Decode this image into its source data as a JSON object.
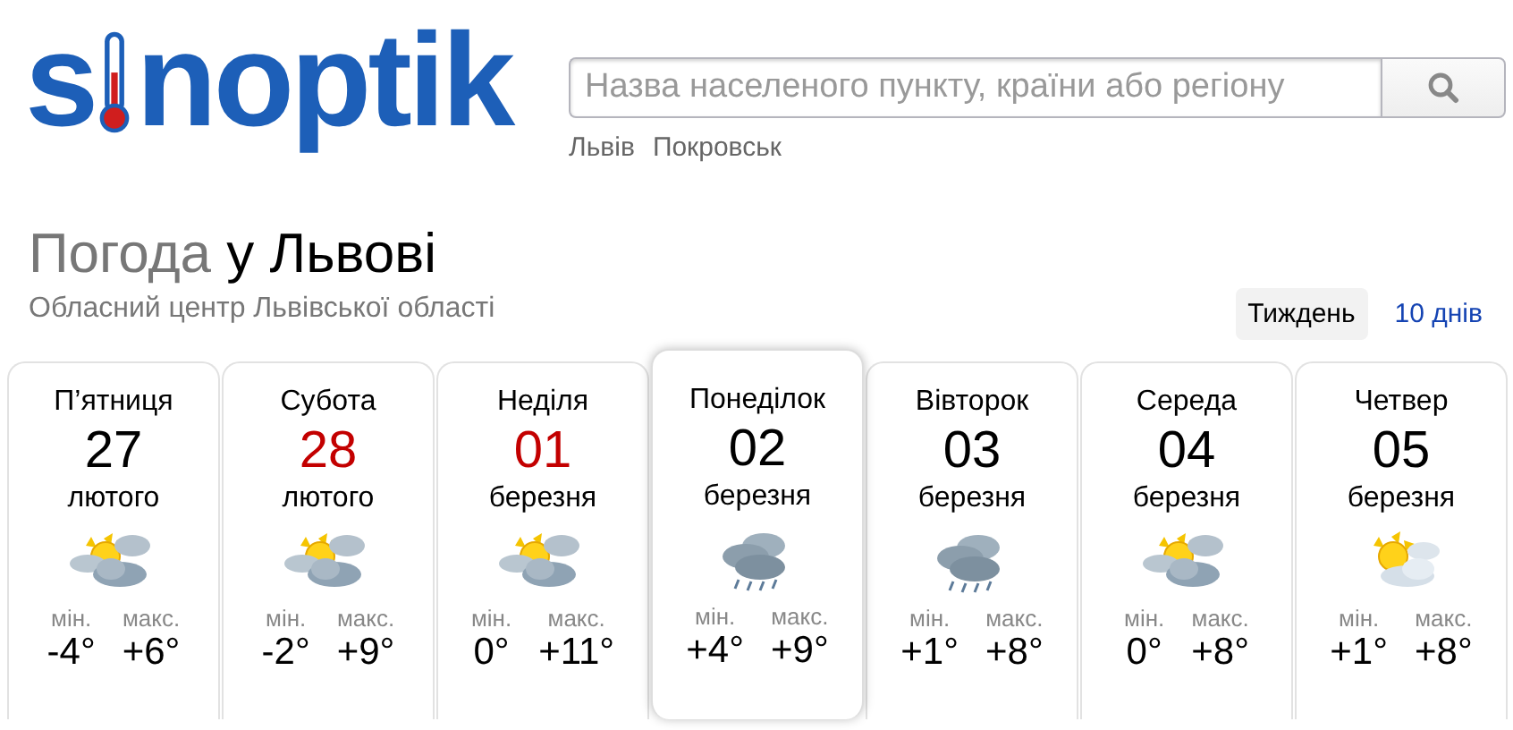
{
  "logo": {
    "text_before": "s",
    "text_after": "noptik"
  },
  "search": {
    "placeholder": "Назва населеного пункту, країни або регіону"
  },
  "recent_links": [
    "Львів",
    "Покровськ"
  ],
  "heading": {
    "prefix": "Погода",
    "city": "у Львові"
  },
  "subtitle": "Обласний центр Львівської області",
  "range_tabs": [
    {
      "label": "Тиждень",
      "selected": true
    },
    {
      "label": "10 днів",
      "selected": false
    }
  ],
  "days": [
    {
      "weekday": "П’ятниця",
      "date": "27",
      "month": "лютого",
      "weekend": false,
      "selected": false,
      "kind": "sun-clouds",
      "min_label": "мін.",
      "min": "-4°",
      "max_label": "макс.",
      "max": "+6°"
    },
    {
      "weekday": "Субота",
      "date": "28",
      "month": "лютого",
      "weekend": true,
      "selected": false,
      "kind": "sun-clouds",
      "min_label": "мін.",
      "min": "-2°",
      "max_label": "макс.",
      "max": "+9°"
    },
    {
      "weekday": "Неділя",
      "date": "01",
      "month": "березня",
      "weekend": true,
      "selected": false,
      "kind": "sun-clouds",
      "min_label": "мін.",
      "min": "0°",
      "max_label": "макс.",
      "max": "+11°"
    },
    {
      "weekday": "Понеділок",
      "date": "02",
      "month": "березня",
      "weekend": false,
      "selected": true,
      "kind": "rain",
      "min_label": "мін.",
      "min": "+4°",
      "max_label": "макс.",
      "max": "+9°"
    },
    {
      "weekday": "Вівторок",
      "date": "03",
      "month": "березня",
      "weekend": false,
      "selected": false,
      "kind": "rain",
      "min_label": "мін.",
      "min": "+1°",
      "max_label": "макс.",
      "max": "+8°"
    },
    {
      "weekday": "Середа",
      "date": "04",
      "month": "березня",
      "weekend": false,
      "selected": false,
      "kind": "sun-clouds",
      "min_label": "мін.",
      "min": "0°",
      "max_label": "макс.",
      "max": "+8°"
    },
    {
      "weekday": "Четвер",
      "date": "05",
      "month": "березня",
      "weekend": false,
      "selected": false,
      "kind": "sun-light-cloud",
      "min_label": "мін.",
      "min": "+1°",
      "max_label": "макс.",
      "max": "+8°"
    }
  ]
}
